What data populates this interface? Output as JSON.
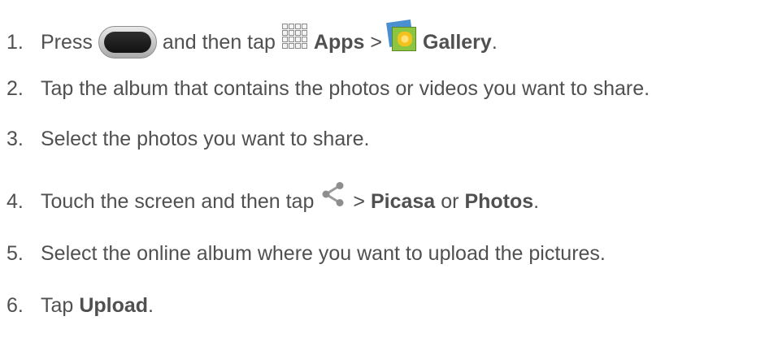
{
  "steps": [
    {
      "number": "1.",
      "parts": {
        "press": "Press",
        "and_then_tap": "and then tap",
        "apps": "Apps",
        "sep": ">",
        "gallery": "Gallery",
        "end": "."
      },
      "icons": [
        "home-key-icon",
        "apps-grid-icon",
        "gallery-icon"
      ]
    },
    {
      "number": "2.",
      "text": "Tap the album that contains the photos or videos you want to share."
    },
    {
      "number": "3.",
      "text": "Select the photos you want to share."
    },
    {
      "number": "4.",
      "parts": {
        "touch": "Touch the screen and then tap",
        "sep": ">",
        "picasa": "Picasa",
        "or": "or",
        "photos": "Photos",
        "end": "."
      },
      "icons": [
        "share-icon"
      ]
    },
    {
      "number": "5.",
      "text": "Select the online album where you want to upload the pictures."
    },
    {
      "number": "6.",
      "parts": {
        "tap": "Tap",
        "upload": "Upload",
        "end": "."
      }
    }
  ],
  "colors": {
    "text": "#505050",
    "home_key_body": "#1e1e1e",
    "gallery_accent": "#8cc640"
  }
}
